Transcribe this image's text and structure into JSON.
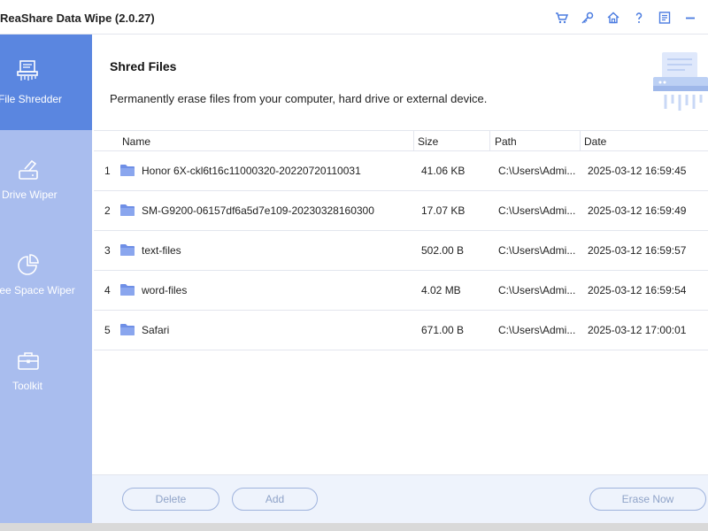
{
  "window": {
    "title": "ReaShare Data Wipe (2.0.27)",
    "toolbar_icons": [
      "cart-icon",
      "key-icon",
      "home-icon",
      "help-icon",
      "feedback-icon",
      "minimize-icon"
    ]
  },
  "sidebar": {
    "items": [
      {
        "label": "File Shredder",
        "icon": "shredder-icon",
        "active": true
      },
      {
        "label": "Drive Wiper",
        "icon": "drive-wiper-icon",
        "active": false
      },
      {
        "label": "Free Space Wiper",
        "icon": "pie-chart-icon",
        "active": false
      },
      {
        "label": "Toolkit",
        "icon": "toolbox-icon",
        "active": false
      }
    ]
  },
  "main": {
    "title": "Shred Files",
    "description": "Permanently erase files from your computer, hard drive or external device.",
    "table": {
      "columns": [
        "Name",
        "Size",
        "Path",
        "Date"
      ],
      "rows": [
        {
          "index": "1",
          "name": "Honor 6X-ckl6t16c11000320-20220720110031",
          "size": "41.06 KB",
          "path": "C:\\Users\\Admi...",
          "date": "2025-03-12 16:59:45"
        },
        {
          "index": "2",
          "name": "SM-G9200-06157df6a5d7e109-20230328160300",
          "size": "17.07 KB",
          "path": "C:\\Users\\Admi...",
          "date": "2025-03-12 16:59:49"
        },
        {
          "index": "3",
          "name": "text-files",
          "size": "502.00 B",
          "path": "C:\\Users\\Admi...",
          "date": "2025-03-12 16:59:57"
        },
        {
          "index": "4",
          "name": "word-files",
          "size": "4.02 MB",
          "path": "C:\\Users\\Admi...",
          "date": "2025-03-12 16:59:54"
        },
        {
          "index": "5",
          "name": "Safari",
          "size": "671.00 B",
          "path": "C:\\Users\\Admi...",
          "date": "2025-03-12 17:00:01"
        }
      ]
    },
    "buttons": {
      "delete": "Delete",
      "add": "Add",
      "erase": "Erase Now"
    }
  },
  "colors": {
    "sidebar_bg": "#a9bdee",
    "sidebar_active": "#5a86e0",
    "accent": "#4a7be0",
    "folder": "#6f8fe6"
  }
}
